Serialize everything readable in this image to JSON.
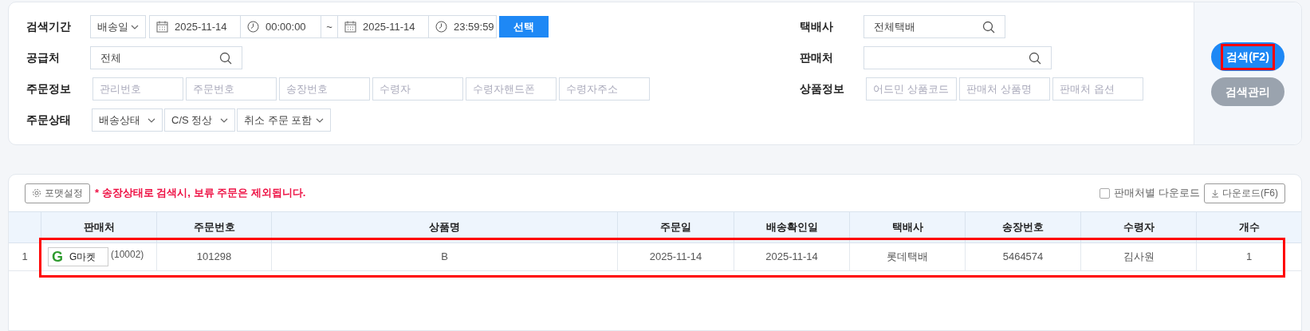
{
  "search_form": {
    "period": {
      "label": "검색기간",
      "date_type": "배송일",
      "start_date": "2025-11-14",
      "start_time": "00:00:00",
      "separator": "~",
      "end_date": "2025-11-14",
      "end_time": "23:59:59",
      "select_button": "선택"
    },
    "supplier": {
      "label": "공급처",
      "value": "전체"
    },
    "order_info": {
      "label": "주문정보",
      "placeholders": [
        "관리번호",
        "주문번호",
        "송장번호",
        "수령자",
        "수령자핸드폰",
        "수령자주소"
      ]
    },
    "order_status": {
      "label": "주문상태",
      "dropdowns": [
        "배송상태",
        "C/S 정상",
        "취소 주문 포함"
      ]
    },
    "courier": {
      "label": "택배사",
      "value": "전체택배"
    },
    "seller": {
      "label": "판매처"
    },
    "product_info": {
      "label": "상품정보",
      "placeholders": [
        "어드민 상품코드",
        "판매처 상품명",
        "판매처 옵션"
      ]
    },
    "buttons": [
      {
        "label": "검색(F2)",
        "kind": "primary",
        "highlighted": true
      },
      {
        "label": "검색관리",
        "kind": "secondary",
        "highlighted": false
      }
    ]
  },
  "results": {
    "format_button": "포맷설정",
    "notice": "* 송장상태로 검색시, 보류 주문은 제외됩니다.",
    "per_seller_download": {
      "label": "판매처별 다운로드",
      "checked": false
    },
    "download_button": "다운로드(F6)",
    "columns": [
      "판매처",
      "주문번호",
      "상품명",
      "주문일",
      "배송확인일",
      "택배사",
      "송장번호",
      "수령자",
      "개수"
    ],
    "rows": [
      {
        "index": "1",
        "seller_logo": "G",
        "seller_name": "G마켓",
        "seller_code": "(10002)",
        "order_no": "101298",
        "product": "B",
        "order_date": "2025-11-14",
        "delivery_date": "2025-11-14",
        "courier": "롯데택배",
        "invoice": "5464574",
        "recipient": "김사원",
        "count": "1",
        "highlighted": true
      }
    ]
  }
}
